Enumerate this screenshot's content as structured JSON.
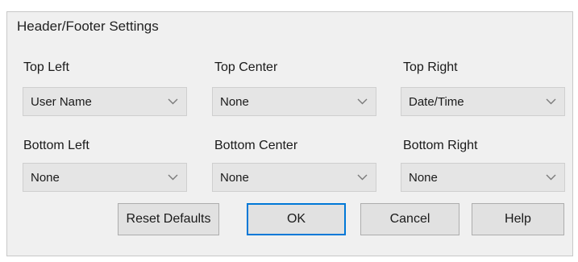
{
  "dialog": {
    "title": "Header/Footer Settings"
  },
  "fields": [
    {
      "label": "Top Left",
      "value": "User Name"
    },
    {
      "label": "Top Center",
      "value": "None"
    },
    {
      "label": "Top Right",
      "value": "Date/Time"
    },
    {
      "label": "Bottom Left",
      "value": "None"
    },
    {
      "label": "Bottom Center",
      "value": "None"
    },
    {
      "label": "Bottom Right",
      "value": "None"
    }
  ],
  "buttons": {
    "reset": "Reset Defaults",
    "ok": "OK",
    "cancel": "Cancel",
    "help": "Help"
  },
  "icons": {
    "dropdown": "chevron-down-icon"
  },
  "colors": {
    "accent": "#0078d7",
    "dialog_bg": "#f0f0f0",
    "combo_bg": "#e5e5e5"
  }
}
